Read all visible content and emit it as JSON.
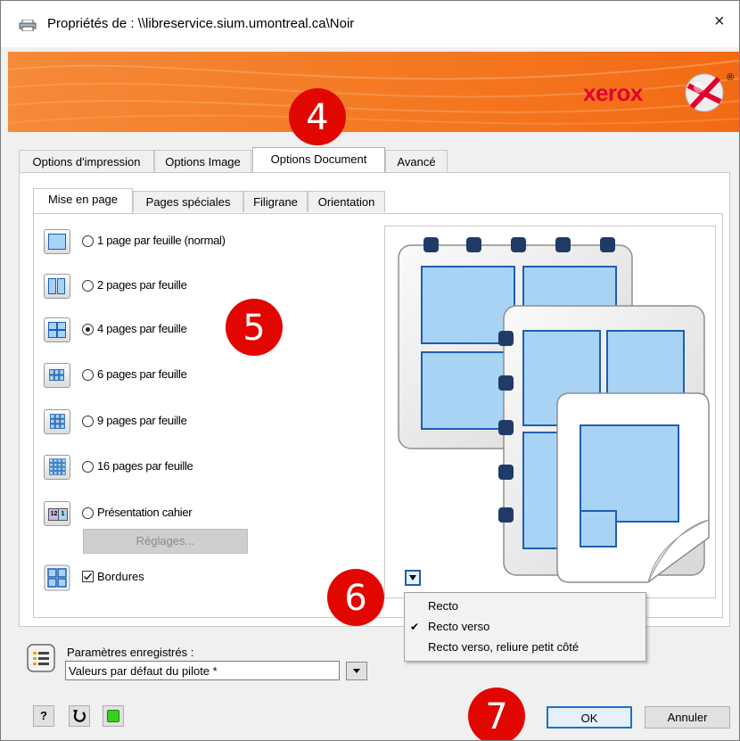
{
  "window": {
    "title": "Propriétés de : \\\\libreservice.sium.umontreal.ca\\Noir",
    "close_label": "×"
  },
  "banner": {
    "brand": "xerox",
    "registered": "®"
  },
  "tabs": [
    {
      "label": "Options d'impression"
    },
    {
      "label": "Options Image"
    },
    {
      "label": "Options Document"
    },
    {
      "label": "Avancé"
    }
  ],
  "subtabs": [
    {
      "label": "Mise en page"
    },
    {
      "label": "Pages spéciales"
    },
    {
      "label": "Filigrane"
    },
    {
      "label": "Orientation"
    }
  ],
  "layout_options": [
    {
      "label": "1 page par feuille (normal)"
    },
    {
      "label": "2 pages par feuille"
    },
    {
      "label": "4 pages par feuille",
      "selected": true
    },
    {
      "label": "6 pages par feuille"
    },
    {
      "label": "9 pages par feuille"
    },
    {
      "label": "16 pages par feuille"
    },
    {
      "label": "Présentation cahier"
    }
  ],
  "booklet_icon_nums": [
    "12",
    "1"
  ],
  "settings_button": "Réglages...",
  "borders": {
    "label": "Bordures",
    "checked": true
  },
  "duplex_menu": {
    "items": [
      "Recto",
      "Recto verso",
      "Recto verso, reliure petit côté"
    ],
    "checked_index": 1,
    "check_glyph": "✔"
  },
  "saved_settings": {
    "label": "Paramètres enregistrés :",
    "value": "Valeurs par défaut du pilote *"
  },
  "footer": {
    "help_label": "?",
    "ok_label": "OK",
    "cancel_label": "Annuler"
  },
  "annotations": [
    "4",
    "5",
    "6",
    "7"
  ],
  "colors": {
    "badge": "#e10600",
    "accent_blue": "#1d5fb0",
    "page_fill": "#a9d3f5",
    "binding": "#1f3b66"
  }
}
